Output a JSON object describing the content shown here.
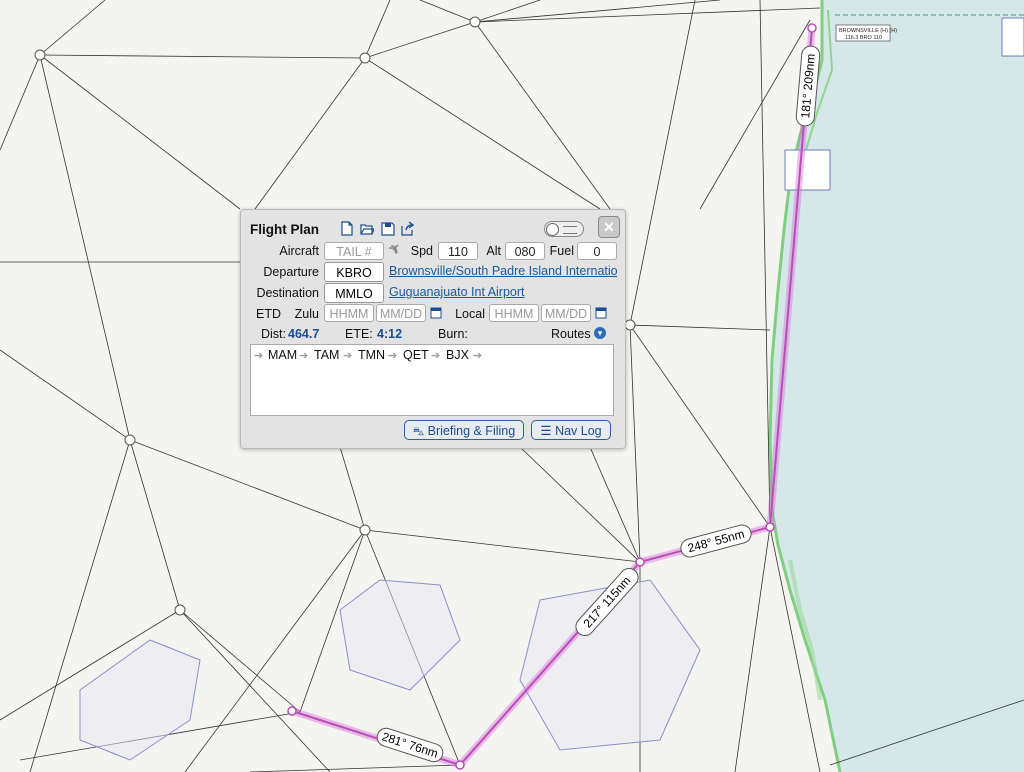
{
  "flight_plan": {
    "title": "Flight Plan",
    "toolbar": {
      "icons": [
        "new-document-icon",
        "open-folder-icon",
        "save-icon",
        "share-icon"
      ]
    },
    "aircraft": {
      "label": "Aircraft",
      "tail_placeholder": "TAIL #"
    },
    "speed": {
      "label": "Spd",
      "value": "110"
    },
    "altitude": {
      "label": "Alt",
      "value": "080"
    },
    "fuel": {
      "label": "Fuel",
      "value": "0"
    },
    "departure": {
      "label": "Departure",
      "code": "KBRO",
      "name": "Brownsville/South Padre Island International Airport"
    },
    "destination": {
      "label": "Destination",
      "code": "MMLO",
      "name": "Guguanajuato Int Airport"
    },
    "etd": {
      "label": "ETD",
      "zulu_label": "Zulu",
      "local_label": "Local",
      "time_placeholder": "HHMM",
      "date_placeholder": "MM/DD"
    },
    "stats": {
      "dist_label": "Dist:",
      "dist_value": "464.7",
      "ete_label": "ETE:",
      "ete_value": "4:12",
      "burn_label": "Burn:"
    },
    "routes_label": "Routes",
    "route": [
      "MAM",
      "TAM",
      "TMN",
      "QET",
      "BJX"
    ],
    "buttons": {
      "briefing": "Briefing & Filing",
      "navlog": "Nav Log"
    }
  },
  "map": {
    "colors": {
      "route": "#d96ed9",
      "water": "#d6e7e9",
      "land": "#f4f4f1",
      "coast": "#8fd48f"
    },
    "leg_labels": [
      "181° 209nm",
      "248° 55nm",
      "217° 115nm",
      "281° 76nm"
    ],
    "station_labels": [
      "BROWNSVILLE (H) (H)",
      "116.3 BRO 110"
    ]
  }
}
